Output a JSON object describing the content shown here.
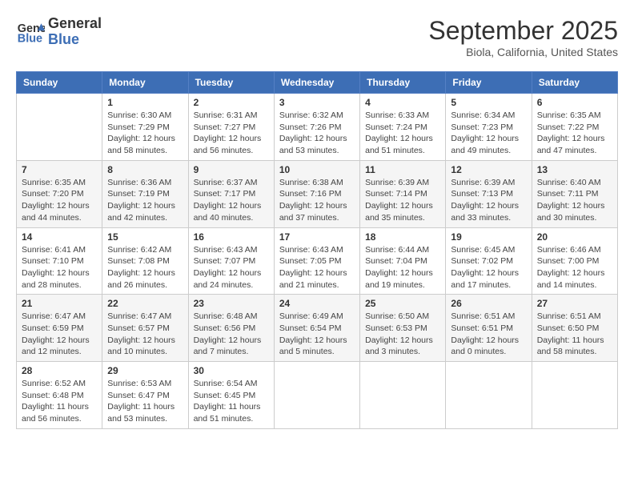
{
  "header": {
    "logo_line1": "General",
    "logo_line2": "Blue",
    "month": "September 2025",
    "location": "Biola, California, United States"
  },
  "weekdays": [
    "Sunday",
    "Monday",
    "Tuesday",
    "Wednesday",
    "Thursday",
    "Friday",
    "Saturday"
  ],
  "weeks": [
    [
      {
        "day": "",
        "info": ""
      },
      {
        "day": "1",
        "info": "Sunrise: 6:30 AM\nSunset: 7:29 PM\nDaylight: 12 hours\nand 58 minutes."
      },
      {
        "day": "2",
        "info": "Sunrise: 6:31 AM\nSunset: 7:27 PM\nDaylight: 12 hours\nand 56 minutes."
      },
      {
        "day": "3",
        "info": "Sunrise: 6:32 AM\nSunset: 7:26 PM\nDaylight: 12 hours\nand 53 minutes."
      },
      {
        "day": "4",
        "info": "Sunrise: 6:33 AM\nSunset: 7:24 PM\nDaylight: 12 hours\nand 51 minutes."
      },
      {
        "day": "5",
        "info": "Sunrise: 6:34 AM\nSunset: 7:23 PM\nDaylight: 12 hours\nand 49 minutes."
      },
      {
        "day": "6",
        "info": "Sunrise: 6:35 AM\nSunset: 7:22 PM\nDaylight: 12 hours\nand 47 minutes."
      }
    ],
    [
      {
        "day": "7",
        "info": "Sunrise: 6:35 AM\nSunset: 7:20 PM\nDaylight: 12 hours\nand 44 minutes."
      },
      {
        "day": "8",
        "info": "Sunrise: 6:36 AM\nSunset: 7:19 PM\nDaylight: 12 hours\nand 42 minutes."
      },
      {
        "day": "9",
        "info": "Sunrise: 6:37 AM\nSunset: 7:17 PM\nDaylight: 12 hours\nand 40 minutes."
      },
      {
        "day": "10",
        "info": "Sunrise: 6:38 AM\nSunset: 7:16 PM\nDaylight: 12 hours\nand 37 minutes."
      },
      {
        "day": "11",
        "info": "Sunrise: 6:39 AM\nSunset: 7:14 PM\nDaylight: 12 hours\nand 35 minutes."
      },
      {
        "day": "12",
        "info": "Sunrise: 6:39 AM\nSunset: 7:13 PM\nDaylight: 12 hours\nand 33 minutes."
      },
      {
        "day": "13",
        "info": "Sunrise: 6:40 AM\nSunset: 7:11 PM\nDaylight: 12 hours\nand 30 minutes."
      }
    ],
    [
      {
        "day": "14",
        "info": "Sunrise: 6:41 AM\nSunset: 7:10 PM\nDaylight: 12 hours\nand 28 minutes."
      },
      {
        "day": "15",
        "info": "Sunrise: 6:42 AM\nSunset: 7:08 PM\nDaylight: 12 hours\nand 26 minutes."
      },
      {
        "day": "16",
        "info": "Sunrise: 6:43 AM\nSunset: 7:07 PM\nDaylight: 12 hours\nand 24 minutes."
      },
      {
        "day": "17",
        "info": "Sunrise: 6:43 AM\nSunset: 7:05 PM\nDaylight: 12 hours\nand 21 minutes."
      },
      {
        "day": "18",
        "info": "Sunrise: 6:44 AM\nSunset: 7:04 PM\nDaylight: 12 hours\nand 19 minutes."
      },
      {
        "day": "19",
        "info": "Sunrise: 6:45 AM\nSunset: 7:02 PM\nDaylight: 12 hours\nand 17 minutes."
      },
      {
        "day": "20",
        "info": "Sunrise: 6:46 AM\nSunset: 7:00 PM\nDaylight: 12 hours\nand 14 minutes."
      }
    ],
    [
      {
        "day": "21",
        "info": "Sunrise: 6:47 AM\nSunset: 6:59 PM\nDaylight: 12 hours\nand 12 minutes."
      },
      {
        "day": "22",
        "info": "Sunrise: 6:47 AM\nSunset: 6:57 PM\nDaylight: 12 hours\nand 10 minutes."
      },
      {
        "day": "23",
        "info": "Sunrise: 6:48 AM\nSunset: 6:56 PM\nDaylight: 12 hours\nand 7 minutes."
      },
      {
        "day": "24",
        "info": "Sunrise: 6:49 AM\nSunset: 6:54 PM\nDaylight: 12 hours\nand 5 minutes."
      },
      {
        "day": "25",
        "info": "Sunrise: 6:50 AM\nSunset: 6:53 PM\nDaylight: 12 hours\nand 3 minutes."
      },
      {
        "day": "26",
        "info": "Sunrise: 6:51 AM\nSunset: 6:51 PM\nDaylight: 12 hours\nand 0 minutes."
      },
      {
        "day": "27",
        "info": "Sunrise: 6:51 AM\nSunset: 6:50 PM\nDaylight: 11 hours\nand 58 minutes."
      }
    ],
    [
      {
        "day": "28",
        "info": "Sunrise: 6:52 AM\nSunset: 6:48 PM\nDaylight: 11 hours\nand 56 minutes."
      },
      {
        "day": "29",
        "info": "Sunrise: 6:53 AM\nSunset: 6:47 PM\nDaylight: 11 hours\nand 53 minutes."
      },
      {
        "day": "30",
        "info": "Sunrise: 6:54 AM\nSunset: 6:45 PM\nDaylight: 11 hours\nand 51 minutes."
      },
      {
        "day": "",
        "info": ""
      },
      {
        "day": "",
        "info": ""
      },
      {
        "day": "",
        "info": ""
      },
      {
        "day": "",
        "info": ""
      }
    ]
  ]
}
